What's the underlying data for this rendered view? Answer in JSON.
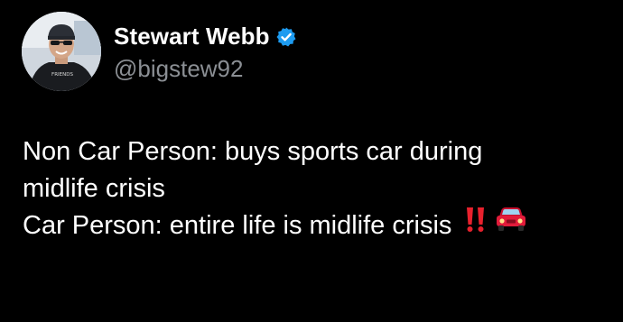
{
  "author": {
    "display_name": "Stewart Webb",
    "handle": "@bigstew92",
    "verified": true,
    "verified_color": "#1d9bf0",
    "avatar_icon": "profile-photo",
    "shirt_text": "FRIENDS"
  },
  "tweet": {
    "lines": [
      "Non Car Person: buys sports car during",
      "midlife crisis",
      "Car Person: entire life is midlife crisis"
    ],
    "emojis": [
      "double-exclamation-icon",
      "car-icon"
    ]
  }
}
